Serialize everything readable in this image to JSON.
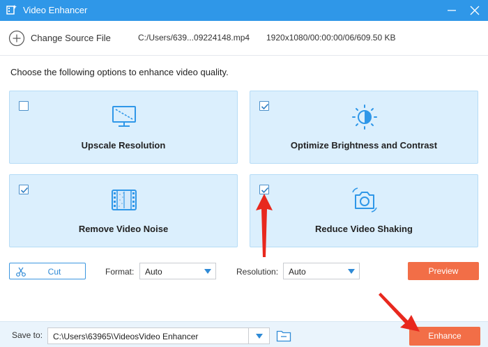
{
  "window": {
    "title": "Video Enhancer"
  },
  "source": {
    "change_label": "Change Source File",
    "path": "C:/Users/639...09224148.mp4",
    "meta": "1920x1080/00:00:00/06/609.50 KB"
  },
  "intro": "Choose the following options to enhance video quality.",
  "options": [
    {
      "label": "Upscale Resolution",
      "checked": false,
      "icon": "monitor-resolution-icon"
    },
    {
      "label": "Optimize Brightness and Contrast",
      "checked": true,
      "icon": "brightness-icon"
    },
    {
      "label": "Remove Video Noise",
      "checked": true,
      "icon": "film-noise-icon"
    },
    {
      "label": "Reduce Video Shaking",
      "checked": true,
      "icon": "camera-stabilize-icon"
    }
  ],
  "controls": {
    "cut_label": "Cut",
    "format_label": "Format:",
    "format_value": "Auto",
    "resolution_label": "Resolution:",
    "resolution_value": "Auto",
    "preview_label": "Preview"
  },
  "footer": {
    "save_label": "Save to:",
    "save_path": "C:\\Users\\63965\\VideosVideo Enhancer",
    "enhance_label": "Enhance"
  },
  "colors": {
    "titlebar": "#2f97e8",
    "card_bg": "#dbeffd",
    "accent_orange": "#f26e47",
    "icon_blue": "#2f97e8",
    "annotation_red": "#e8281e"
  }
}
